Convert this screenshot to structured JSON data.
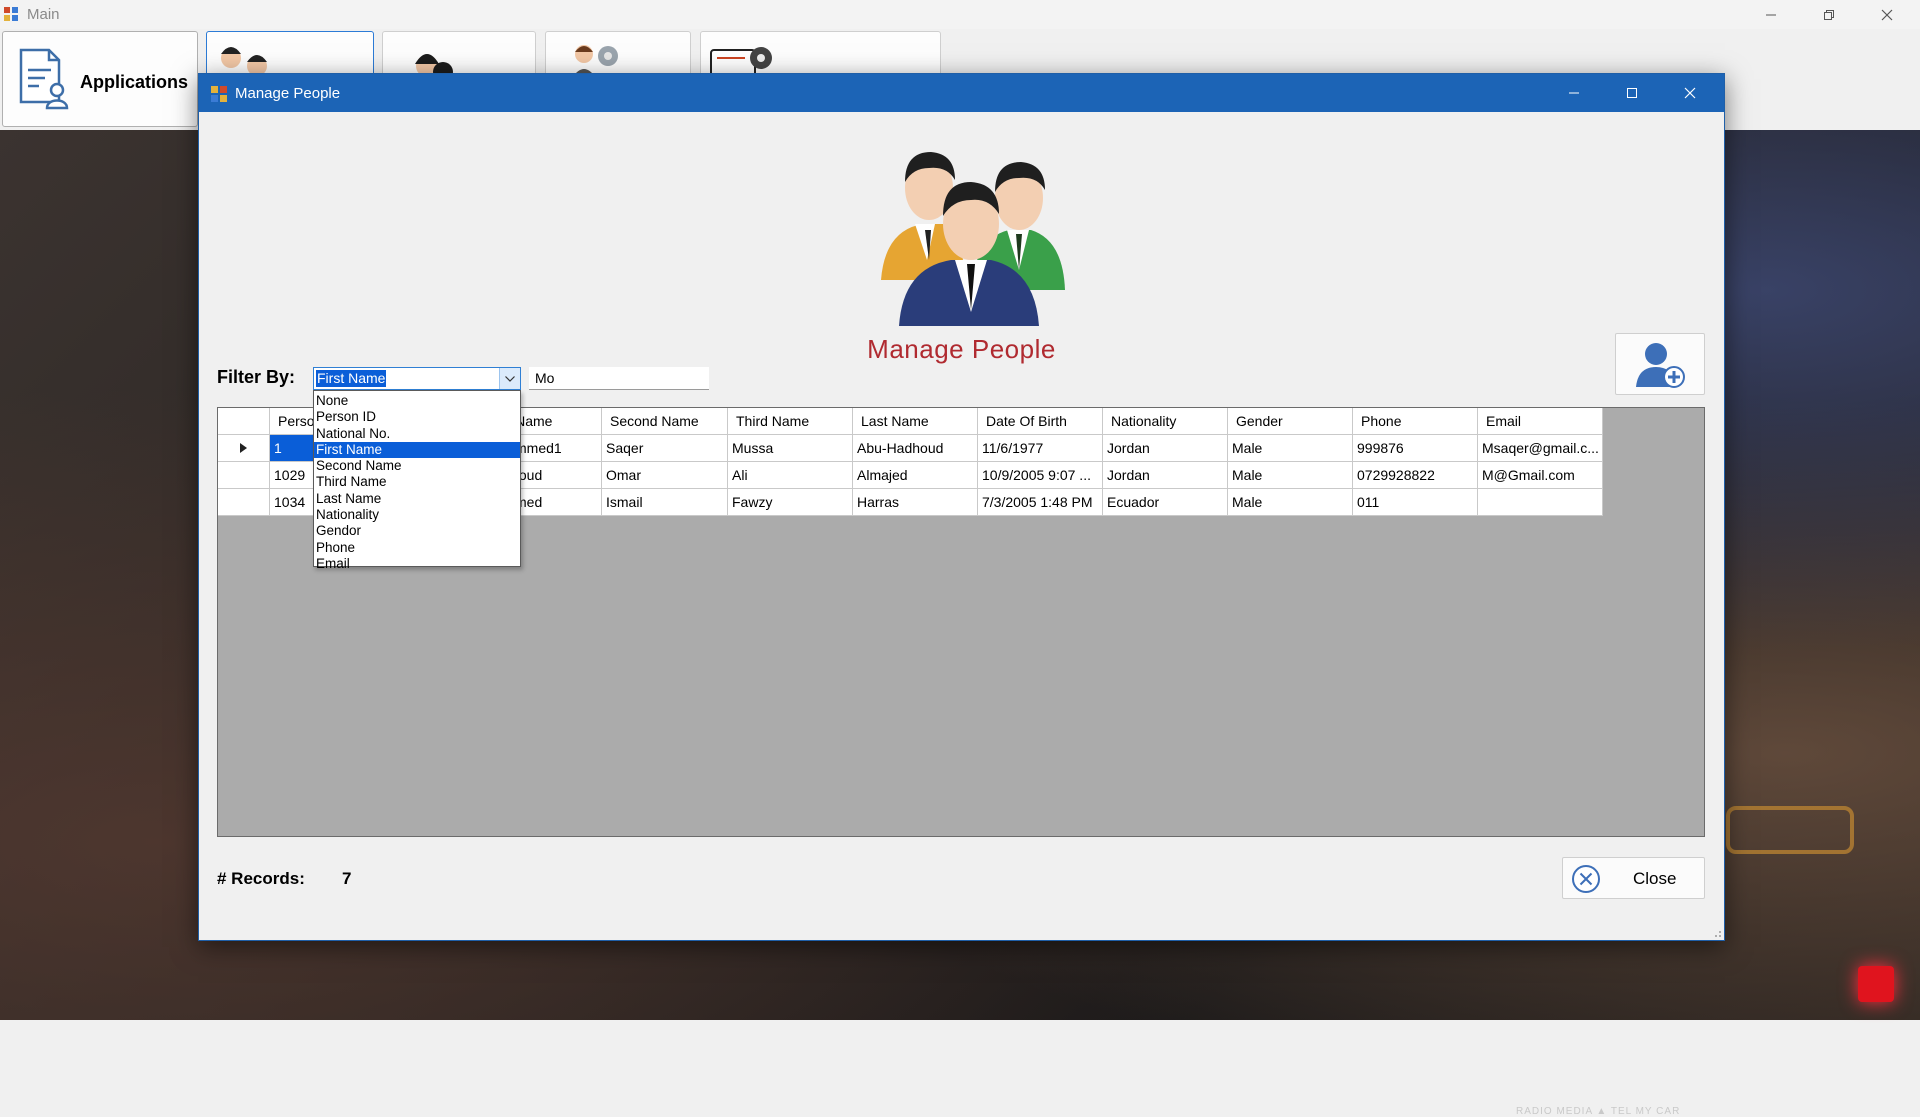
{
  "main_window": {
    "title": "Main",
    "toolbar": {
      "applications_label": "Applications"
    }
  },
  "dialog": {
    "title": "Manage People",
    "heading": "Manage People"
  },
  "filter": {
    "label": "Filter By:",
    "selected": "First Name",
    "value": "Mo",
    "options": [
      "None",
      "Person ID",
      "National No.",
      "First Name",
      "Second Name",
      "Third Name",
      "Last Name",
      "Nationality",
      "Gendor",
      "Phone",
      "Email"
    ]
  },
  "grid": {
    "columns": [
      "Perso",
      "",
      "First Name",
      "Second Name",
      "Third Name",
      "Last Name",
      "Date Of Birth",
      "Nationality",
      "Gender",
      "Phone",
      "Email"
    ],
    "rows": [
      [
        "1",
        "",
        "Mohammed1",
        "Saqer",
        "Mussa",
        "Abu-Hadhoud",
        "11/6/1977",
        "Jordan",
        "Male",
        "999876",
        "Msaqer@gmail.c..."
      ],
      [
        "1029",
        "",
        "Mahmoud",
        "Omar",
        "Ali",
        "Almajed",
        "10/9/2005 9:07 ...",
        "Jordan",
        "Male",
        "0729928822",
        "M@Gmail.com"
      ],
      [
        "1034",
        "",
        "Mohamed",
        "Ismail",
        "Fawzy",
        "Harras",
        "7/3/2005 1:48 PM",
        "Ecuador",
        "Male",
        "011",
        ""
      ]
    ]
  },
  "footer": {
    "records_label": "# Records:",
    "records_count": "7",
    "close_label": "Close"
  },
  "background": {
    "console_labels": "RADIO   MEDIA   ▲   TEL   MY CAR"
  },
  "colors": {
    "titlebar": "#1c64b6",
    "selection": "#0a5ed8",
    "heading": "#b02a30"
  }
}
